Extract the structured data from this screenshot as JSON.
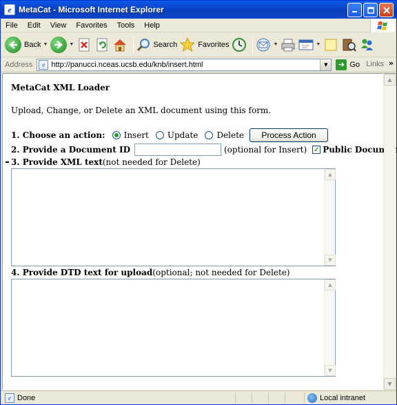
{
  "window": {
    "title": "MetaCat - Microsoft Internet Explorer",
    "app_icon_glyph": "e"
  },
  "menubar": {
    "items": [
      {
        "label": "File",
        "underline": "F",
        "rest": "ile"
      },
      {
        "label": "Edit",
        "underline": "E",
        "rest": "dit"
      },
      {
        "label": "View",
        "underline": "V",
        "rest": "iew"
      },
      {
        "label": "Favorites",
        "underline": "F",
        "rest": "a",
        "pre": "",
        "full": "Favorites"
      },
      {
        "label": "Tools",
        "underline": "T",
        "rest": "ools"
      },
      {
        "label": "Help",
        "underline": "H",
        "rest": "elp"
      }
    ]
  },
  "toolbar": {
    "back_label": "Back",
    "search_label": "Search",
    "favorites_label": "Favorites"
  },
  "addressbar": {
    "label": "Address",
    "url": "http://panucci.nceas.ucsb.edu/knb/insert.html",
    "go_label": "Go",
    "links_label": "Links"
  },
  "page": {
    "heading": "MetaCat XML Loader",
    "intro": "Upload, Change, or Delete an XML document using this form.",
    "step1_label": "1. Choose an action:",
    "action_options": [
      "Insert",
      "Update",
      "Delete"
    ],
    "action_selected": "Insert",
    "process_button": "Process Action",
    "step2_label": "2. Provide a Document ID",
    "docid_value": "",
    "docid_hint": "(optional for Insert)",
    "public_label": "Public Document",
    "public_checked": true,
    "step3_label": "3. Provide XML text",
    "step3_hint": " (not needed for Delete)",
    "xml_text": "",
    "step4_label": "4. Provide DTD text for upload",
    "step4_hint": " (optional; not needed for Delete)",
    "dtd_text": ""
  },
  "statusbar": {
    "status_text": "Done",
    "zone_text": "Local intranet"
  },
  "colors": {
    "titlebar": "#0a47c8",
    "window_face": "#ece9d8",
    "radio_dot": "#21a121"
  }
}
